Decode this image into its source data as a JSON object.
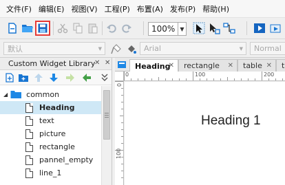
{
  "menu": [
    "文件(F)",
    "编辑(E)",
    "视图(V)",
    "工程(P)",
    "布置(A)",
    "发布(P)",
    "帮助(H)"
  ],
  "toolbar": {
    "zoom_value": "100%",
    "selected_button": "save",
    "icons": [
      "new-file-icon",
      "open-folder-icon",
      "save-icon",
      "cut-icon",
      "copy-icon",
      "paste-icon",
      "undo-icon",
      "redo-icon",
      "select-intersect-icon",
      "select-contain-icon",
      "connector-icon",
      "preview-icon"
    ]
  },
  "format_bar": {
    "style_select": "默认",
    "font_select": "Arial",
    "weight_select": "Normal"
  },
  "left_panel": {
    "title": "Custom Widget Library",
    "folder": "common",
    "items": [
      "Heading",
      "text",
      "picture",
      "rectangle",
      "pannel_empty",
      "line_1"
    ],
    "selected_item": "Heading"
  },
  "tabs": [
    {
      "label": "Heading",
      "active": true
    },
    {
      "label": "rectangle",
      "active": false
    },
    {
      "label": "table",
      "active": false
    },
    {
      "label": "te",
      "active": false
    }
  ],
  "ruler": {
    "h_labels": [
      "0",
      "100",
      "200"
    ],
    "v_labels": [
      "0",
      "100"
    ]
  },
  "canvas": {
    "heading_text": "Heading 1"
  },
  "colors": {
    "selected_row": "#cfe8f6",
    "highlight_border": "#e53935",
    "accent_blue": "#1e88e5",
    "accent_green": "#43a047"
  }
}
